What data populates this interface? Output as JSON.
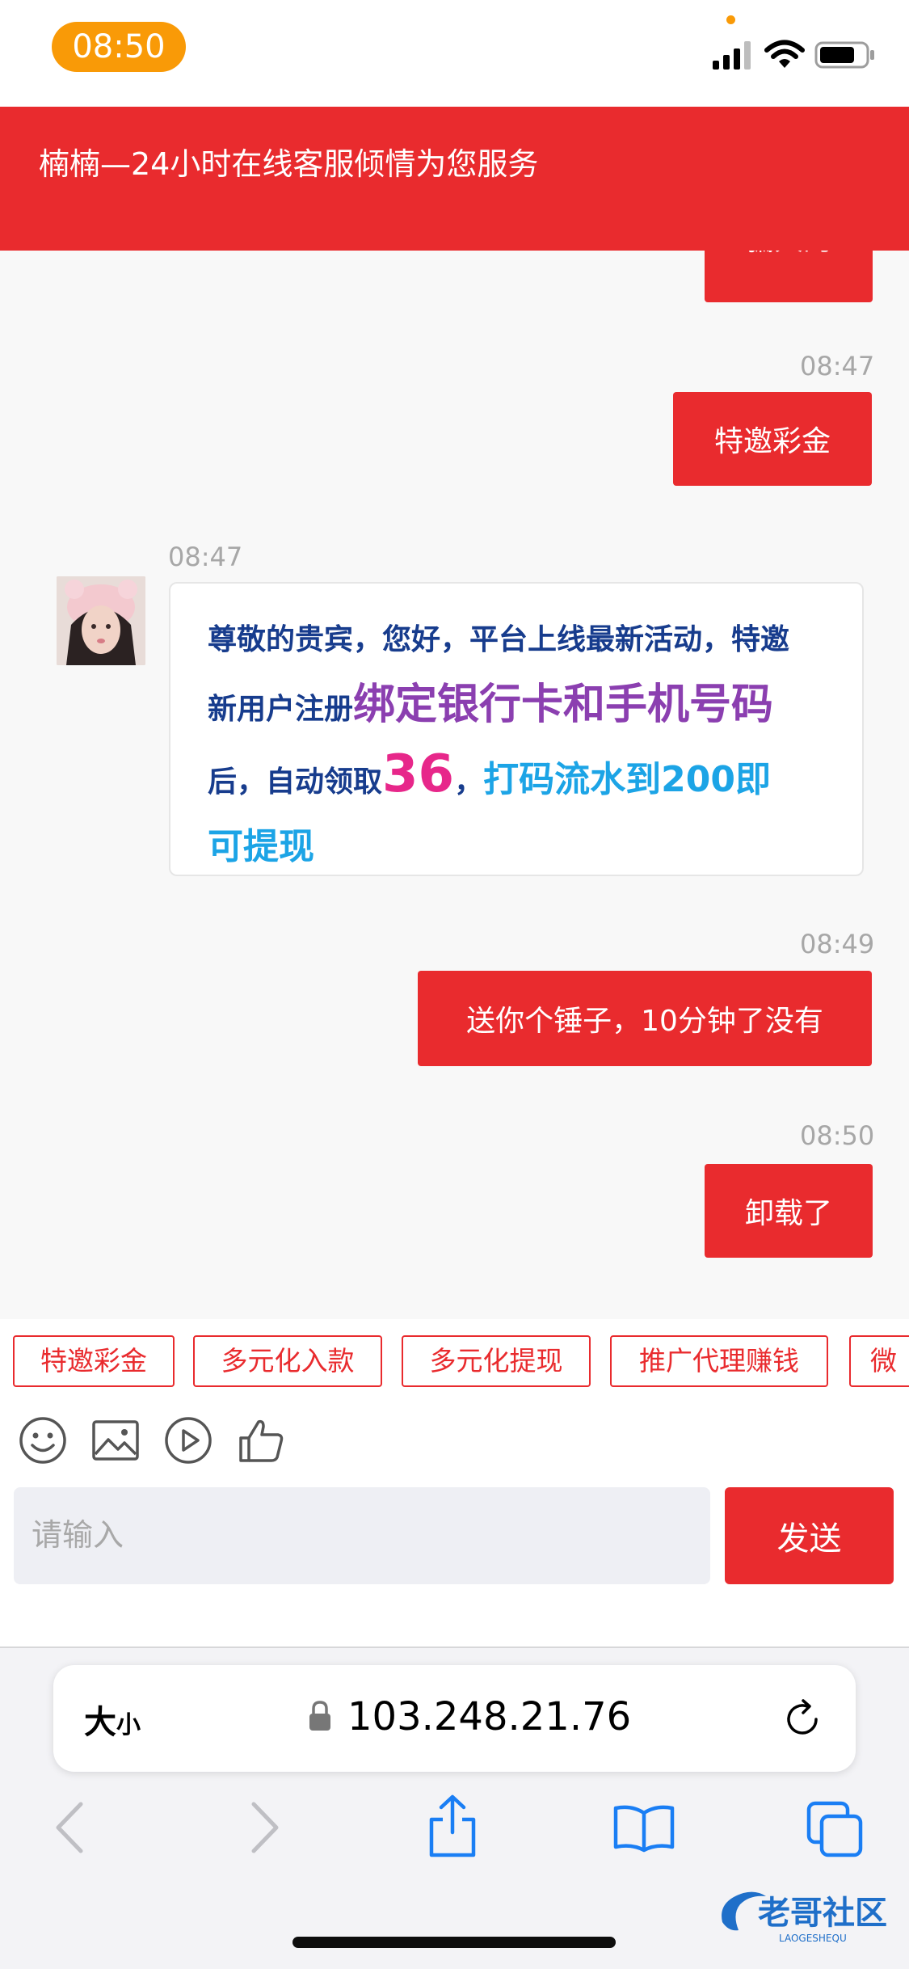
{
  "status_bar": {
    "time": "08:50"
  },
  "header": {
    "title": "楠楠—24小时在线客服倾情为您服务"
  },
  "messages": {
    "partial": {
      "text": "骗人的"
    },
    "m1": {
      "time": "08:47",
      "text": "特邀彩金"
    },
    "m2": {
      "time": "08:47",
      "p1": "尊敬的贵宾，您好，平台上线最新活动，特邀新用户注册",
      "p2": "绑定银行卡和手机号码",
      "p3": "后，自动领取",
      "p4": "36",
      "p5": "，",
      "p6": "打码流水到200即可提现"
    },
    "m3": {
      "time": "08:49",
      "text": "送你个锤子，10分钟了没有"
    },
    "m4": {
      "time": "08:50",
      "text": "卸载了"
    }
  },
  "quick_replies": [
    "特邀彩金",
    "多元化入款",
    "多元化提现",
    "推广代理赚钱",
    "微"
  ],
  "toolbar": {
    "icons": [
      "emoji-icon",
      "image-icon",
      "video-icon",
      "thumbs-up-icon"
    ]
  },
  "composer": {
    "placeholder": "请输入",
    "send_label": "发送"
  },
  "browser": {
    "text_size": "大",
    "text_size_small": "小",
    "url": "103.248.21.76"
  },
  "watermark": {
    "text": "老哥社区",
    "sub": "LAOGESHEQU"
  },
  "colors": {
    "brand_red": "#e92b2e",
    "status_pill": "#f99a07",
    "msg_navy": "#173c8d",
    "msg_purple": "#8b3fb0",
    "msg_pink": "#e7278a",
    "msg_blue": "#1ca4e6"
  }
}
